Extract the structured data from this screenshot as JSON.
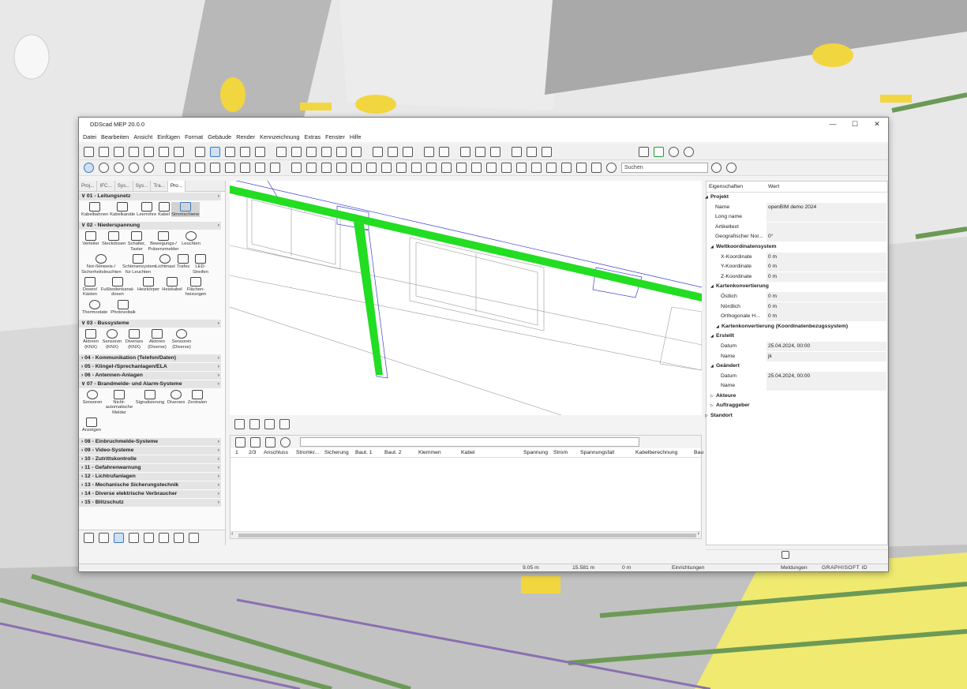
{
  "app": {
    "title": "DDScad MEP 20.0.0"
  },
  "window_controls": [
    "—",
    "☐",
    "✕"
  ],
  "menu": [
    "Datei",
    "Bearbeiten",
    "Ansicht",
    "Einfügen",
    "Format",
    "Gebäude",
    "Render",
    "Kennzeichnung",
    "Extras",
    "Fenster",
    "Hilfe"
  ],
  "search": {
    "placeholder": "Suchen"
  },
  "left_tabs": [
    "Proj...",
    "IFC...",
    "Sys...",
    "Sys...",
    "Tra...",
    "Pro..."
  ],
  "sections": [
    {
      "label": "01 - Leitungsnetz",
      "expanded": true,
      "items": [
        "Kabelbahnen",
        "Kabelkanäle",
        "Leerrohre",
        "Kabel",
        "Stromschiene"
      ]
    },
    {
      "label": "02 - Niederspannung",
      "expanded": true,
      "items": [
        "Verteiler",
        "Steckdosen",
        "Schalter, Taster",
        "Bewegungs-/ Präsenzmelder",
        "Leuchten",
        "Not-/Hinweis-/ Sicherheitsleuchten",
        "Schienensystem für Leuchten",
        "Lichtmast",
        "Trafos",
        "LED-Streifen",
        "Dosen/ Kästen",
        "Fußbodenkanal-dosen",
        "Heizkörper",
        "Heizkabel",
        "Flächen-heizungen",
        "Thermostate",
        "Photovoltaik"
      ]
    },
    {
      "label": "03 - Bussysteme",
      "expanded": true,
      "items": [
        "Aktoren (KNX)",
        "Sensoren (KNX)",
        "Diverses (KNX)",
        "Aktoren (Diverse)",
        "Sensoren (Diverse)"
      ]
    },
    {
      "label": "04 - Kommunikation (Telefon/Daten)",
      "expanded": false
    },
    {
      "label": "05 - Klingel-/Sprechanlagen/ELA",
      "expanded": false
    },
    {
      "label": "06 - Antennen-Anlagen",
      "expanded": false
    },
    {
      "label": "07 - Brandmelde- und Alarm-Systeme",
      "expanded": true,
      "items": [
        "Sensoren",
        "Nicht-automatische Melder",
        "Signalisierung",
        "Diverses",
        "Zentralen",
        "Anzeigen"
      ]
    },
    {
      "label": "08 - Einbruchmelde-Systeme",
      "expanded": false
    },
    {
      "label": "09 - Video-Systeme",
      "expanded": false
    },
    {
      "label": "10 - Zutrittskontrolle",
      "expanded": false
    },
    {
      "label": "11 - Gefahrenwarnung",
      "expanded": false
    },
    {
      "label": "12 - Lichtrufanlagen",
      "expanded": false
    },
    {
      "label": "13 - Mechanische Sicherungstechnik",
      "expanded": false
    },
    {
      "label": "14 - Diverse elektrische Verbraucher",
      "expanded": false
    },
    {
      "label": "15 - Blitzschutz",
      "expanded": false
    }
  ],
  "table_columns": [
    "1",
    "2/3",
    "Anschluss",
    "Stromkr...",
    "Sicherung",
    "Baut. 1",
    "Baut. 2",
    "Klemmen",
    "Kabel",
    "Spannung",
    "Strom",
    "Spannungsfall",
    "Kabelberechnung",
    "Bau"
  ],
  "properties": {
    "col1": "Eigenschaften",
    "col2": "Wert",
    "rows": [
      {
        "label": "Projekt",
        "group": true,
        "indent": 1,
        "open": true
      },
      {
        "label": "Name",
        "value": "openBIM demo 2024",
        "indent": 2
      },
      {
        "label": "Long name",
        "value": "",
        "indent": 2
      },
      {
        "label": "Artikeltext",
        "value": "",
        "indent": 2
      },
      {
        "label": "Geografischer Nor...",
        "value": "0°",
        "indent": 2
      },
      {
        "label": "Weltkoordinatensystem",
        "group": true,
        "indent": 2,
        "open": true
      },
      {
        "label": "X-Koordinate",
        "value": "0 m",
        "indent": 3
      },
      {
        "label": "Y-Koordinate",
        "value": "0 m",
        "indent": 3
      },
      {
        "label": "Z-Koordinate",
        "value": "0 m",
        "indent": 3
      },
      {
        "label": "Kartenkonvertierung",
        "group": true,
        "indent": 2,
        "open": true
      },
      {
        "label": "Östlich",
        "value": "0 m",
        "indent": 3
      },
      {
        "label": "Nördlich",
        "value": "0 m",
        "indent": 3
      },
      {
        "label": "Orthogonale H...",
        "value": "0 m",
        "indent": 3
      },
      {
        "label": "Kartenkonvertierung (Koordinatenbezugssystem)",
        "group": true,
        "indent": 3,
        "open": true
      },
      {
        "label": "Erstellt",
        "group": true,
        "indent": 2,
        "open": true
      },
      {
        "label": "Datum",
        "value": "25.04.2024, 00:00",
        "indent": 3
      },
      {
        "label": "Name",
        "value": "jk",
        "indent": 3
      },
      {
        "label": "Geändert",
        "group": true,
        "indent": 2,
        "open": true
      },
      {
        "label": "Datum",
        "value": "25.04.2024, 00:00",
        "indent": 3
      },
      {
        "label": "Name",
        "value": "",
        "indent": 3
      },
      {
        "label": "Akteure",
        "group": true,
        "indent": 2,
        "open": false
      },
      {
        "label": "Auftraggeber",
        "group": true,
        "indent": 2,
        "open": false
      },
      {
        "label": "Standort",
        "group": true,
        "indent": 1,
        "open": false
      }
    ]
  },
  "status": {
    "x": "9.05 m",
    "y": "15.581 m",
    "z": "0 m",
    "mode": "Einrichtungen",
    "messages": "Meldungen",
    "brand": "GRAPHISOFT ID"
  },
  "colors": {
    "cable_tray": "#22dd22",
    "accent": "#3b78c4",
    "confirm": "#1e9e3a"
  }
}
